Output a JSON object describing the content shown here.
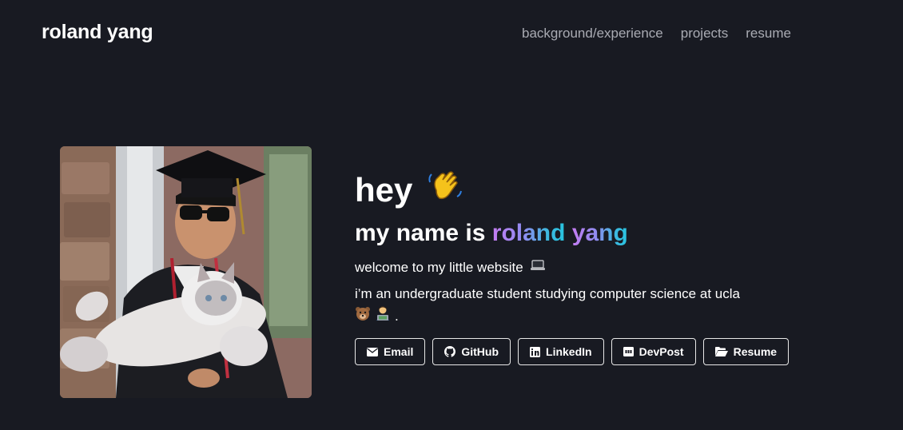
{
  "header": {
    "brand": "roland yang",
    "nav": [
      {
        "label": "background/experience"
      },
      {
        "label": "projects"
      },
      {
        "label": "resume"
      }
    ]
  },
  "hero": {
    "greeting": "hey",
    "greeting_icon": "waving-hand-emoji",
    "name_prefix": "my name is",
    "name_first": "roland",
    "name_last": "yang",
    "name_gradient_colors": [
      "#c47cf2",
      "#8d8df0",
      "#3fb8e0",
      "#27c4e0"
    ],
    "intro": "welcome to my little website",
    "intro_icon": "laptop-emoji",
    "bio": "i’m an undergraduate student studying computer science at ucla",
    "bio_icons": [
      "bear-emoji",
      "technologist-emoji"
    ],
    "bio_end": "."
  },
  "photo": {
    "alt_icon": "graduation-photo-with-cat"
  },
  "buttons": [
    {
      "label": "Email",
      "icon": "envelope-icon"
    },
    {
      "label": "GitHub",
      "icon": "github-icon"
    },
    {
      "label": "LinkedIn",
      "icon": "linkedin-icon"
    },
    {
      "label": "DevPost",
      "icon": "devpost-icon"
    },
    {
      "label": "Resume",
      "icon": "folder-open-icon"
    }
  ],
  "colors": {
    "background": "#181a22",
    "text": "#ffffff",
    "nav_text": "#a9abb3",
    "button_border": "#e8e8e8"
  }
}
